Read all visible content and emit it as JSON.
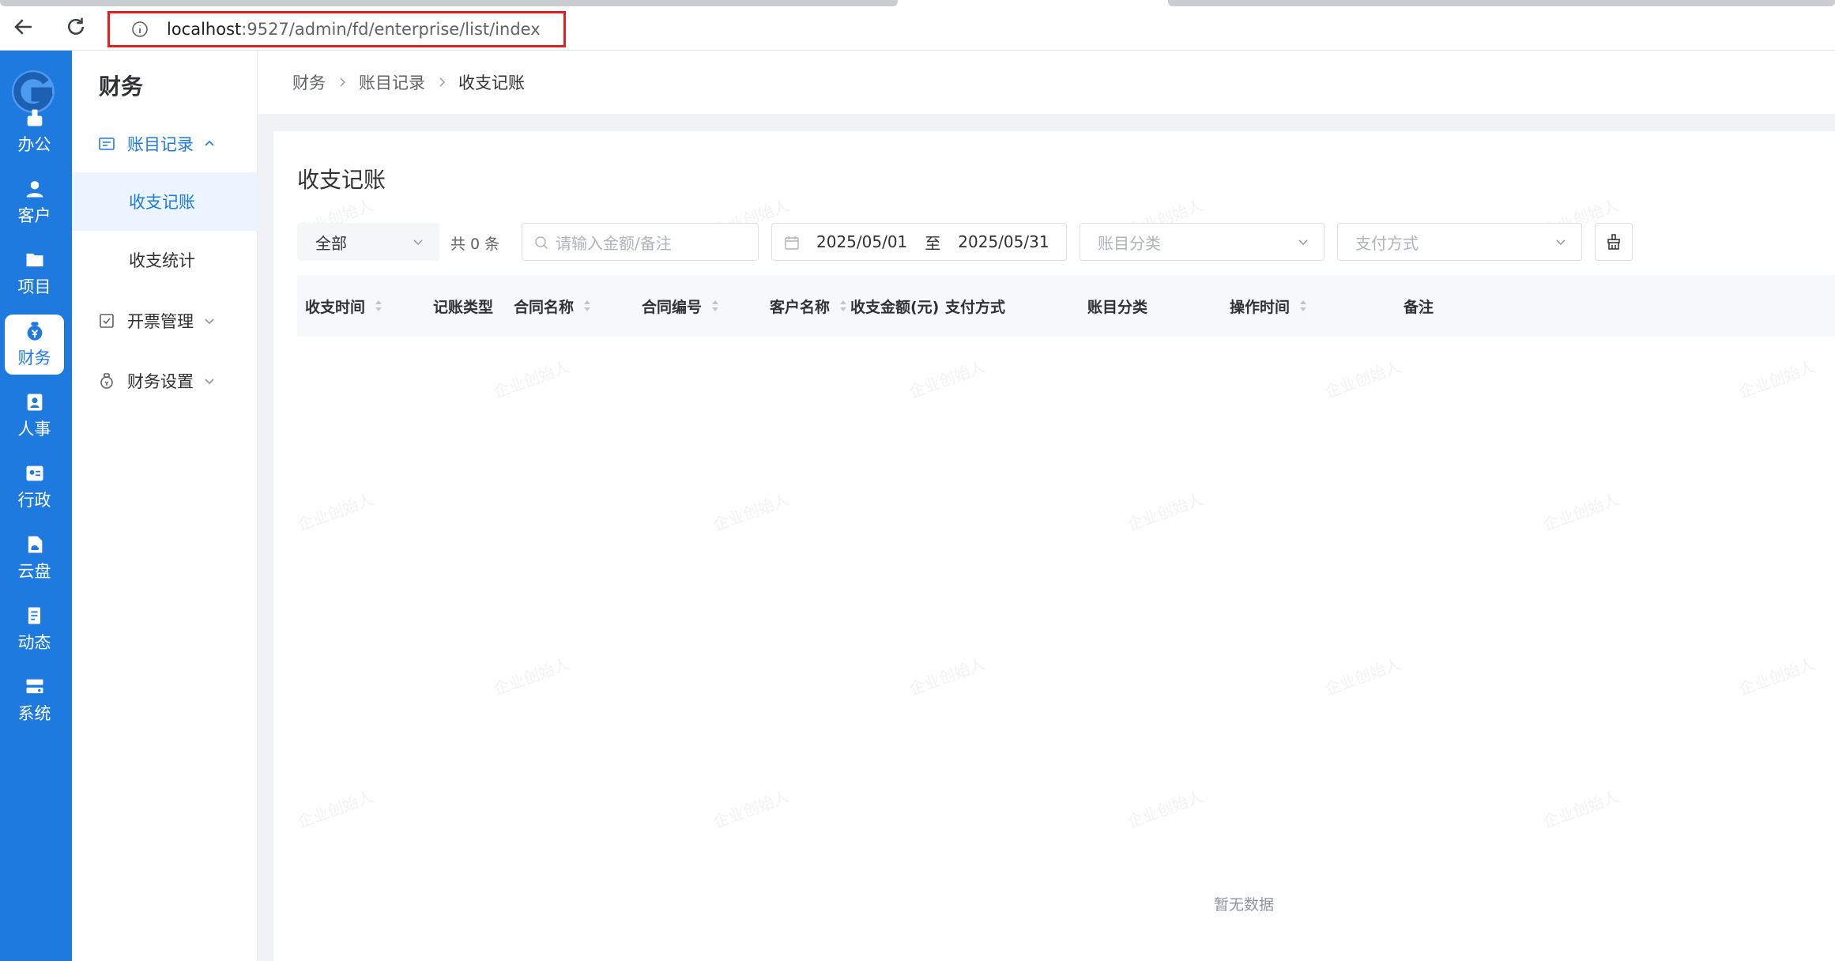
{
  "browser": {
    "url_host": "localhost",
    "url_path": ":9527/admin/fd/enterprise/list/index"
  },
  "rail": {
    "items": [
      {
        "label": "办公",
        "icon": "office-icon"
      },
      {
        "label": "客户",
        "icon": "customer-icon"
      },
      {
        "label": "项目",
        "icon": "project-icon"
      },
      {
        "label": "财务",
        "icon": "finance-icon",
        "active": true
      },
      {
        "label": "人事",
        "icon": "hr-icon"
      },
      {
        "label": "行政",
        "icon": "admin-icon"
      },
      {
        "label": "云盘",
        "icon": "cloud-disk-icon"
      },
      {
        "label": "动态",
        "icon": "news-icon"
      },
      {
        "label": "系统",
        "icon": "system-icon"
      }
    ]
  },
  "submenu": {
    "title": "财务",
    "groups": [
      {
        "label": "账目记录",
        "open": true,
        "icon": "ledger-icon"
      },
      {
        "label": "开票管理",
        "open": false,
        "icon": "invoice-icon"
      },
      {
        "label": "财务设置",
        "open": false,
        "icon": "finance-settings-icon"
      }
    ],
    "sub_items": [
      {
        "label": "收支记账",
        "active": true
      },
      {
        "label": "收支统计",
        "active": false
      }
    ]
  },
  "breadcrumb": [
    "财务",
    "账目记录",
    "收支记账"
  ],
  "page": {
    "title": "收支记账",
    "filter_type": "全部",
    "count_text": "共 0 条",
    "search_placeholder": "请输入金额/备注",
    "date_start": "2025/05/01",
    "date_sep": "至",
    "date_end": "2025/05/31",
    "category_placeholder": "账目分类",
    "payment_placeholder": "支付方式",
    "empty_text": "暂无数据"
  },
  "table": {
    "columns": [
      {
        "label": "收支时间",
        "sortable": true
      },
      {
        "label": "记账类型",
        "sortable": false
      },
      {
        "label": "合同名称",
        "sortable": true
      },
      {
        "label": "合同编号",
        "sortable": true
      },
      {
        "label": "客户名称",
        "sortable": true
      },
      {
        "label": "收支金额(元)",
        "sortable": false
      },
      {
        "label": "支付方式",
        "sortable": false
      },
      {
        "label": "账目分类",
        "sortable": false
      },
      {
        "label": "操作时间",
        "sortable": true
      },
      {
        "label": "备注",
        "sortable": false
      }
    ],
    "rows": []
  },
  "watermark": "企业创始人",
  "colors": {
    "primary": "#1f7ae0",
    "highlight_border": "#e02020"
  }
}
